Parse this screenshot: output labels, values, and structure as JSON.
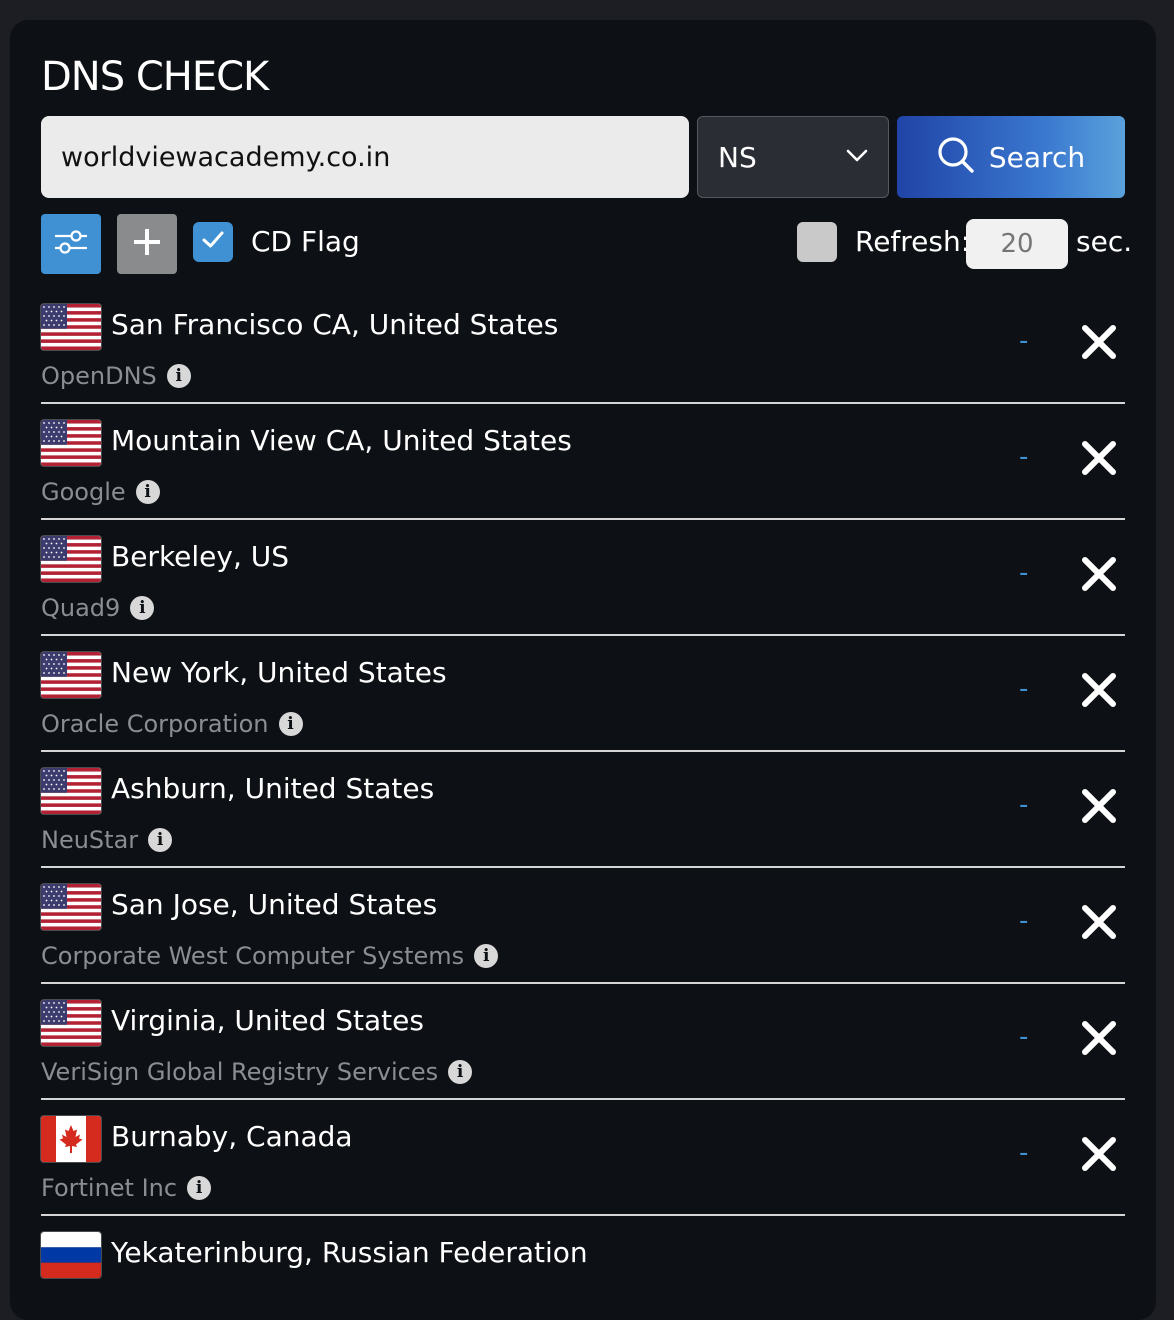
{
  "app": {
    "title": "DNS CHECK"
  },
  "search": {
    "domain_value": "worldviewacademy.co.in",
    "record_type": "NS",
    "search_label": "Search"
  },
  "options": {
    "cd_flag_label": "CD Flag",
    "cd_flag_checked": true,
    "refresh_label": "Refresh:",
    "refresh_checked": false,
    "refresh_placeholder": "20",
    "refresh_unit": "sec."
  },
  "colors": {
    "accent": "#3f91d3",
    "panel_bg": "#0d1014",
    "page_bg": "#1c1e24"
  },
  "servers": [
    {
      "flag": "us-flag-icon",
      "location": "San Francisco CA, United States",
      "provider": "OpenDNS",
      "result": "-"
    },
    {
      "flag": "us-flag-icon",
      "location": "Mountain View CA, United States",
      "provider": "Google",
      "result": "-"
    },
    {
      "flag": "us-flag-icon",
      "location": "Berkeley, US",
      "provider": "Quad9",
      "result": "-"
    },
    {
      "flag": "us-flag-icon",
      "location": "New York, United States",
      "provider": "Oracle Corporation",
      "result": "-"
    },
    {
      "flag": "us-flag-icon",
      "location": "Ashburn, United States",
      "provider": "NeuStar",
      "result": "-"
    },
    {
      "flag": "us-flag-icon",
      "location": "San Jose, United States",
      "provider": "Corporate West Computer Systems",
      "result": "-"
    },
    {
      "flag": "us-flag-icon",
      "location": "Virginia, United States",
      "provider": "VeriSign Global Registry Services",
      "result": "-"
    },
    {
      "flag": "ca-flag-icon",
      "location": "Burnaby, Canada",
      "provider": "Fortinet Inc",
      "result": "-"
    },
    {
      "flag": "ru-flag-icon",
      "location": "Yekaterinburg, Russian Federation",
      "provider": "",
      "result": ""
    }
  ]
}
